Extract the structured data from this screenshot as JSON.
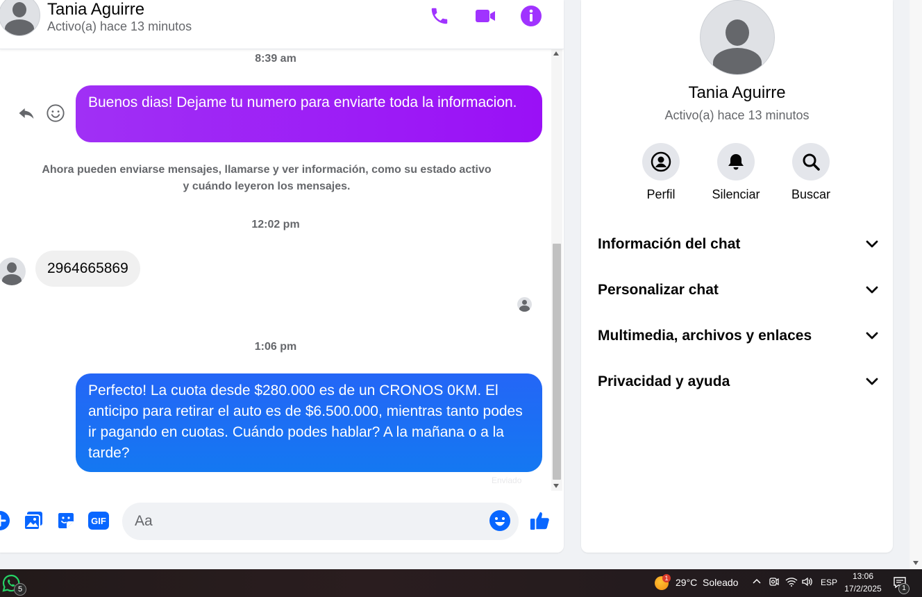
{
  "chat": {
    "contact_name": "Tania Aguirre",
    "contact_status": "Activo(a) hace 13 minutos",
    "header_icons": [
      "phone-icon",
      "video-camera-icon",
      "info-icon"
    ],
    "accent_color": "#a033ff",
    "messages": [
      {
        "type": "timestamp",
        "text": "8:39 am"
      },
      {
        "type": "outgoing",
        "text": "Buenos dias! Dejame tu numero para enviarte toda la informacion.",
        "color": "#9b1af6"
      },
      {
        "type": "system",
        "text": "Ahora pueden enviarse mensajes, llamarse y ver información, como su estado activo y cuándo leyeron los mensajes."
      },
      {
        "type": "timestamp",
        "text": "12:02 pm"
      },
      {
        "type": "incoming",
        "text": "2964665869"
      },
      {
        "type": "timestamp",
        "text": "1:06 pm"
      },
      {
        "type": "outgoing",
        "text": "Perfecto! La cuota desde $280.000 es de un CRONOS 0KM. El anticipo para retirar el auto es de $6.500.000, mientras tanto podes ir pagando en cuotas. Cuándo podes hablar? A la mañana o a la tarde?",
        "color": "#1e6cf5"
      }
    ],
    "faded_label": "Enviado",
    "composer": {
      "placeholder": "Aa",
      "icons": [
        "plus-icon",
        "image-icon",
        "sticker-icon",
        "gif-icon",
        "emoji-icon",
        "thumbs-up-icon"
      ]
    }
  },
  "info_panel": {
    "name": "Tania Aguirre",
    "status": "Activo(a) hace 13 minutos",
    "actions": [
      {
        "label": "Perfil",
        "icon": "profile-icon"
      },
      {
        "label": "Silenciar",
        "icon": "bell-icon"
      },
      {
        "label": "Buscar",
        "icon": "search-icon"
      }
    ],
    "sections": [
      {
        "label": "Información del chat"
      },
      {
        "label": "Personalizar chat"
      },
      {
        "label": "Multimedia, archivos y enlaces"
      },
      {
        "label": "Privacidad y ayuda"
      }
    ]
  },
  "taskbar": {
    "whatsapp_badge": "5",
    "weather_badge": "1",
    "weather": "29°C  Soleado",
    "language": "ESP",
    "time": "13:06",
    "date": "17/2/2025",
    "notification_badge": "1"
  }
}
